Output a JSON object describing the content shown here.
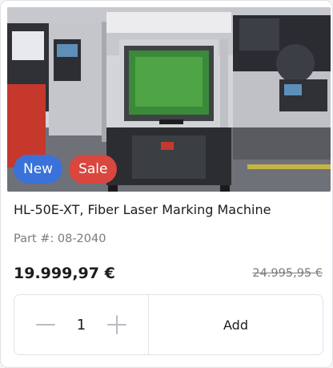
{
  "product": {
    "image_alt": "Fiber laser marking machine in a workshop",
    "badges": {
      "new": "New",
      "sale": "Sale"
    },
    "title": "HL-50E-XT, Fiber Laser Marking Machine",
    "part_number": "Part #: 08-2040",
    "price": "19.999,97 €",
    "old_price": "24.995,95 €"
  },
  "cart": {
    "quantity": "1",
    "add_label": "Add"
  },
  "colors": {
    "badge_new": "#3a72d9",
    "badge_sale": "#d9473f",
    "text": "#1c1c1e",
    "muted": "#7a7a80"
  }
}
